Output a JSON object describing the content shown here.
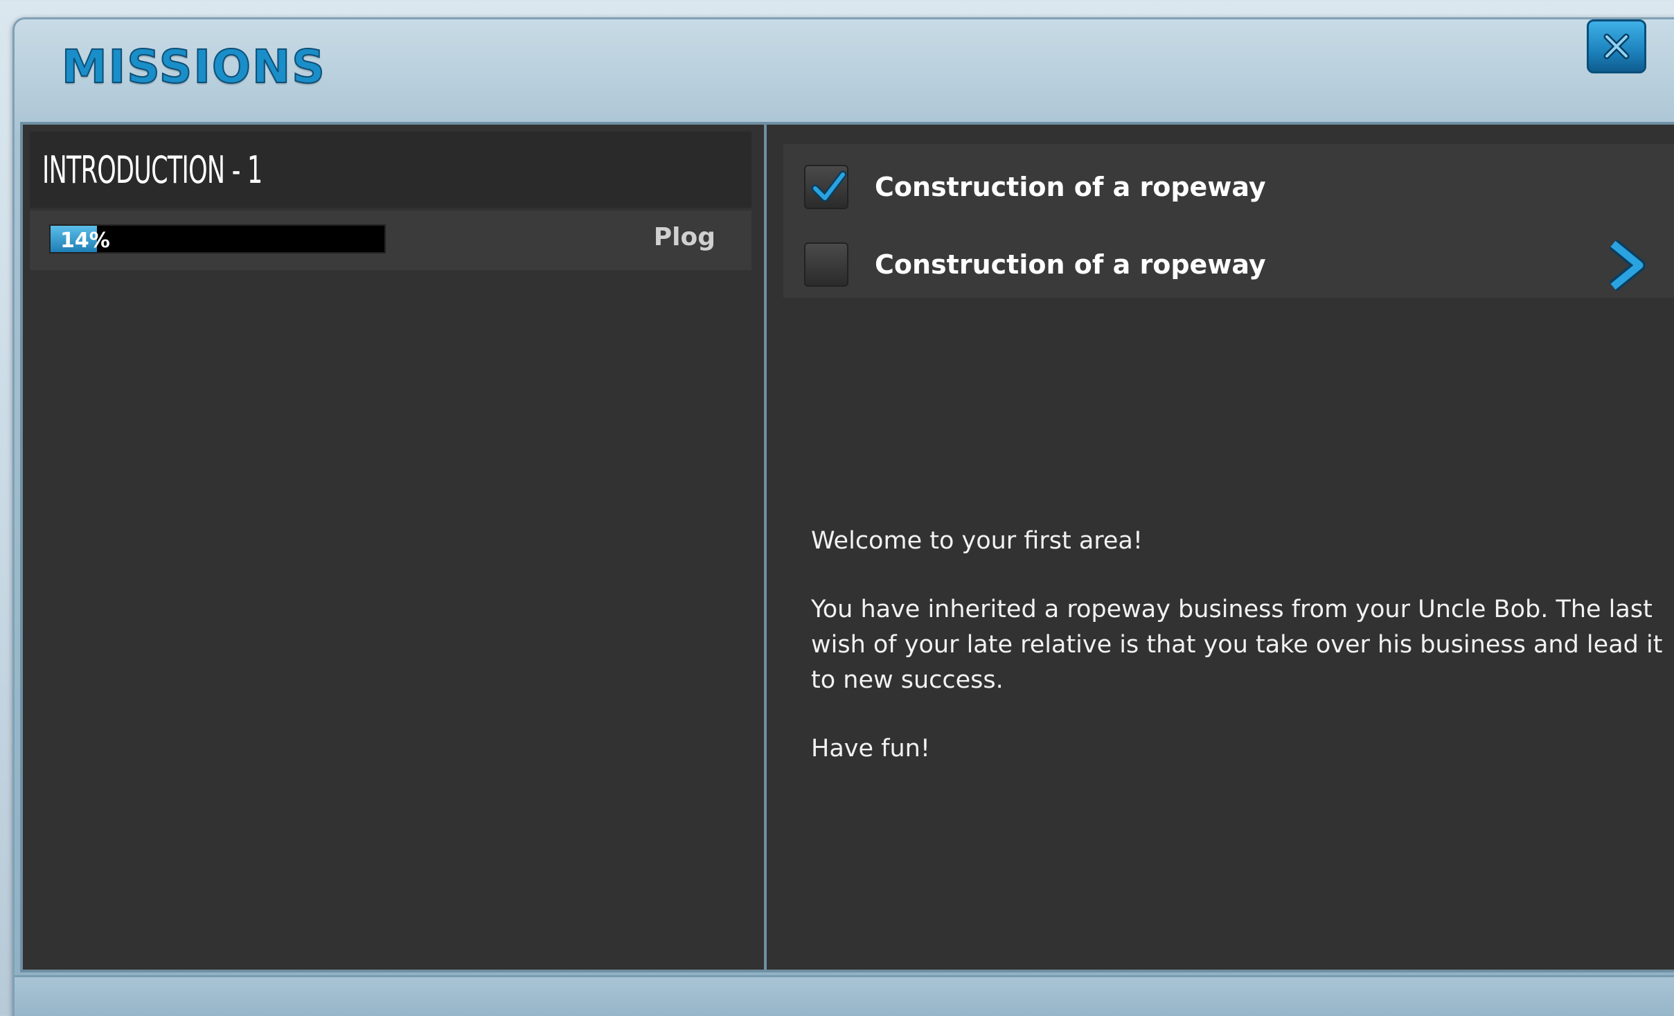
{
  "window": {
    "title": "MISSIONS",
    "close_icon": "close-icon"
  },
  "mission": {
    "title": "INTRODUCTION - 1",
    "progress_percent": 14,
    "progress_label": "14%",
    "tag": "Plog"
  },
  "objectives": [
    {
      "label": "Construction of a ropeway",
      "completed": true,
      "icon": "checkmark-icon"
    },
    {
      "label": "Construction of a ropeway",
      "completed": false,
      "icon": "chevron-right-icon"
    }
  ],
  "description": {
    "greeting": "Welcome to your first area!",
    "body": "You have inherited a ropeway business from your Uncle Bob. The last wish of your late relative is that you take over his business and lead it to new success.",
    "closing": "Have fun!"
  },
  "colors": {
    "accent": "#1a8ec8",
    "panel": "#323232",
    "frame": "#8fb0c4"
  }
}
